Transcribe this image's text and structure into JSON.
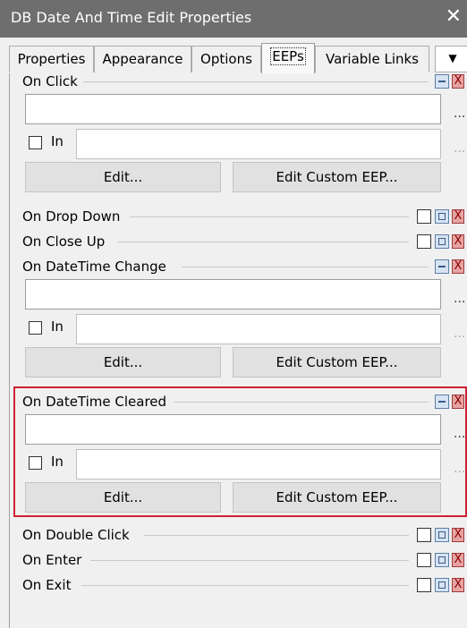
{
  "window": {
    "title": "DB Date And Time Edit Properties",
    "close_glyph": "✕"
  },
  "tabs": [
    {
      "label": "Properties",
      "active": false
    },
    {
      "label": "Appearance",
      "active": false
    },
    {
      "label": "Options",
      "active": false
    },
    {
      "label": "EEPs",
      "active": true
    },
    {
      "label": "Variable Links",
      "active": false
    }
  ],
  "tab_scroll_glyph": "▼",
  "events": {
    "on_click": {
      "label": "On Click",
      "in_label": "In",
      "edit_label": "Edit...",
      "custom_label": "Edit Custom EEP...",
      "browse": "...",
      "browse_in": "..."
    },
    "on_drop_down": {
      "label": "On Drop Down"
    },
    "on_close_up": {
      "label": "On Close Up"
    },
    "on_datetime_change": {
      "label": "On DateTime Change",
      "in_label": "In",
      "edit_label": "Edit...",
      "custom_label": "Edit Custom EEP...",
      "browse": "...",
      "browse_in": "..."
    },
    "on_datetime_cleared": {
      "label": "On DateTime Cleared",
      "in_label": "In",
      "edit_label": "Edit...",
      "custom_label": "Edit Custom EEP...",
      "browse": "...",
      "browse_in": "..."
    },
    "on_double_click": {
      "label": "On Double Click"
    },
    "on_enter": {
      "label": "On Enter"
    },
    "on_exit": {
      "label": "On Exit"
    }
  },
  "icons": {
    "close_glyph": "X"
  },
  "colors": {
    "titlebar": "#6e6e6e",
    "highlight": "#cc2233",
    "button": "#e1e1e1"
  }
}
